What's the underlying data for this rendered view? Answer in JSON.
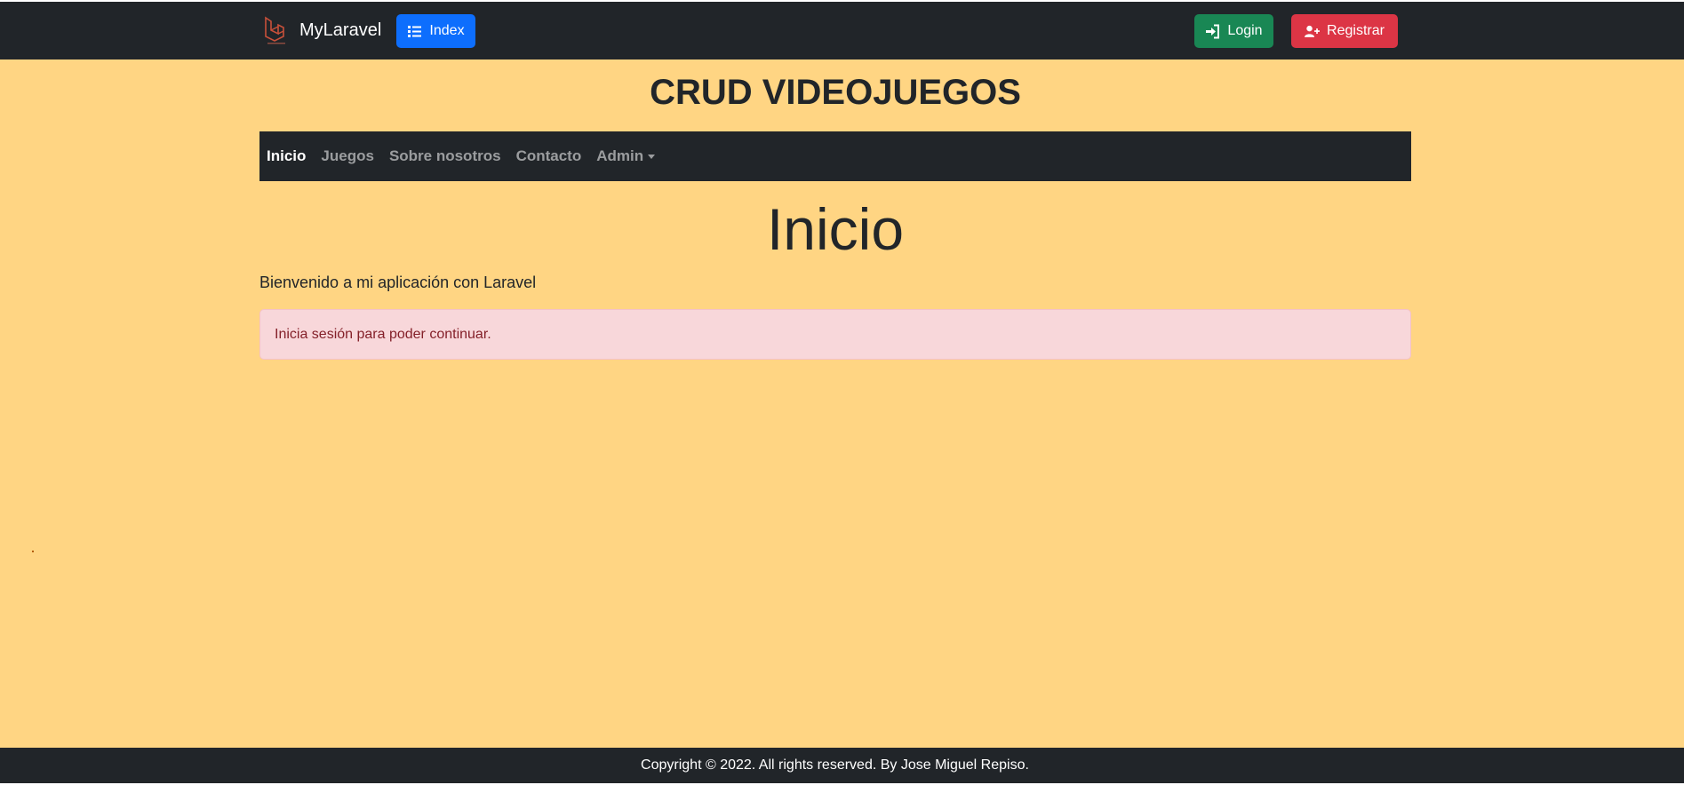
{
  "header": {
    "brand": "MyLaravel",
    "index_label": "Index",
    "login_label": "Login",
    "register_label": "Registrar"
  },
  "site_title": "CRUD VIDEOJUEGOS",
  "nav": {
    "items": [
      "Inicio",
      "Juegos",
      "Sobre nosotros",
      "Contacto",
      "Admin"
    ],
    "active": "Inicio"
  },
  "content": {
    "heading": "Inicio",
    "welcome": "Bienvenido a mi aplicación con Laravel",
    "alert": "Inicia sesión para poder continuar."
  },
  "footer": {
    "text": "Copyright © 2022. All rights reserved. By Jose Miguel Repiso."
  },
  "colors": {
    "navbar": "#212529",
    "background": "#ffd583",
    "primary": "#0d6efd",
    "success": "#198754",
    "danger": "#dc3545",
    "alert_bg": "#f8d7da",
    "alert_text": "#842029"
  },
  "icons": {
    "brand": "laravel-logo-icon",
    "index": "list-icon",
    "login": "sign-in-icon",
    "register": "user-plus-icon",
    "admin": "caret-down-icon"
  }
}
